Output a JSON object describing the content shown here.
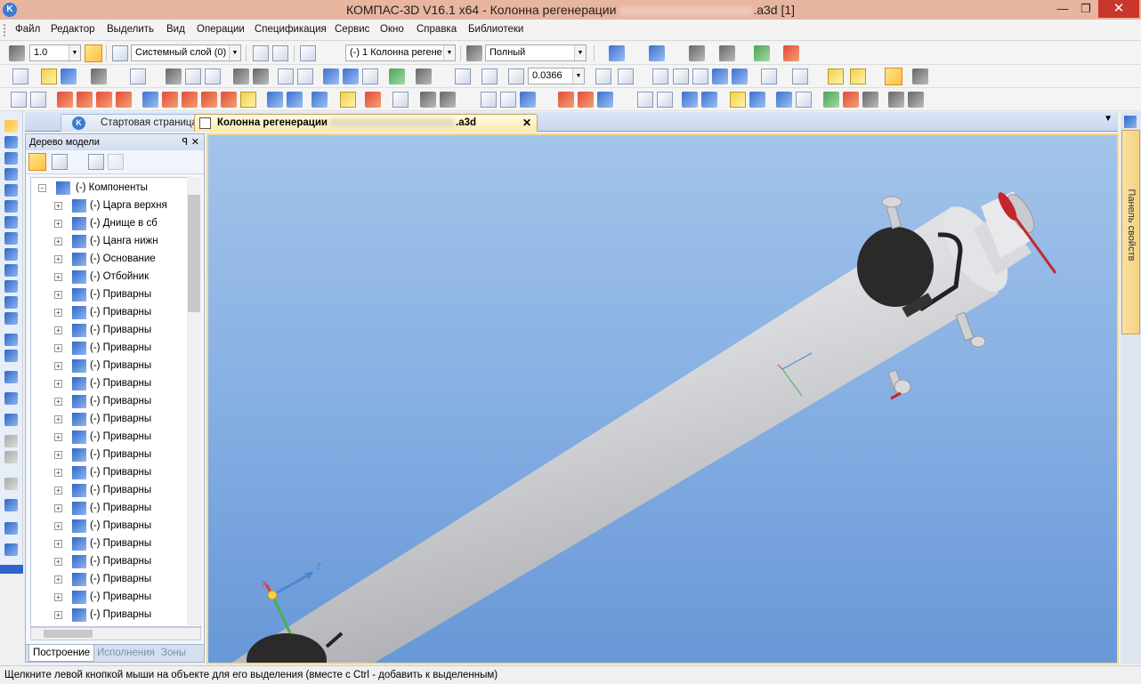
{
  "window": {
    "title": "КОМПАС-3D V16.1 x64 - Колонна регенерации",
    "title_suffix": ".a3d [1]",
    "min": "—",
    "max": "❐",
    "close": "✕"
  },
  "menu": [
    "Файл",
    "Редактор",
    "Выделить",
    "Вид",
    "Операции",
    "Спецификация",
    "Сервис",
    "Окно",
    "Справка",
    "Библиотеки"
  ],
  "toolbar1": {
    "scale": "1.0",
    "layer": "Системный слой (0)",
    "component": "(-) 1 Колонна регене",
    "view_mode": "Полный"
  },
  "toolbar2": {
    "zoom": "0.0366"
  },
  "tabs": {
    "start": "Стартовая страница",
    "doc": "Колонна регенерации",
    "doc_ext": ".a3d",
    "close": "✕"
  },
  "tree": {
    "title": "Дерево модели",
    "pin": "ᵖ",
    "close": "✕",
    "root": "(-) Компоненты",
    "items": [
      "(-)  Царга верхня",
      "(-)  Днище в сб",
      "(-)  Цанга нижн",
      "(-)  Основание",
      "(-)  Отбойник",
      "(-)  Приварны",
      "(-)  Приварны",
      "(-)  Приварны",
      "(-)  Приварны",
      "(-)  Приварны",
      "(-)  Приварны",
      "(-)  Приварны",
      "(-)  Приварны",
      "(-)  Приварны",
      "(-)  Приварны",
      "(-)  Приварны",
      "(-)  Приварны",
      "(-)  Приварны",
      "(-)  Приварны",
      "(-)  Приварны",
      "(-)  Приварны",
      "(-)  Приварны",
      "(-)  Приварны",
      "(-)  Приварны"
    ],
    "bottom_tabs": [
      "Построение",
      "Исполнения",
      "Зоны"
    ]
  },
  "right_panel": {
    "label": "Панель свойств"
  },
  "viewport": {
    "axis_z": "Z",
    "axis_x": "X",
    "axis_y": "Y"
  },
  "status": "Щелкните левой кнопкой мыши на объекте для его выделения (вместе с Ctrl - добавить к выделенным)"
}
